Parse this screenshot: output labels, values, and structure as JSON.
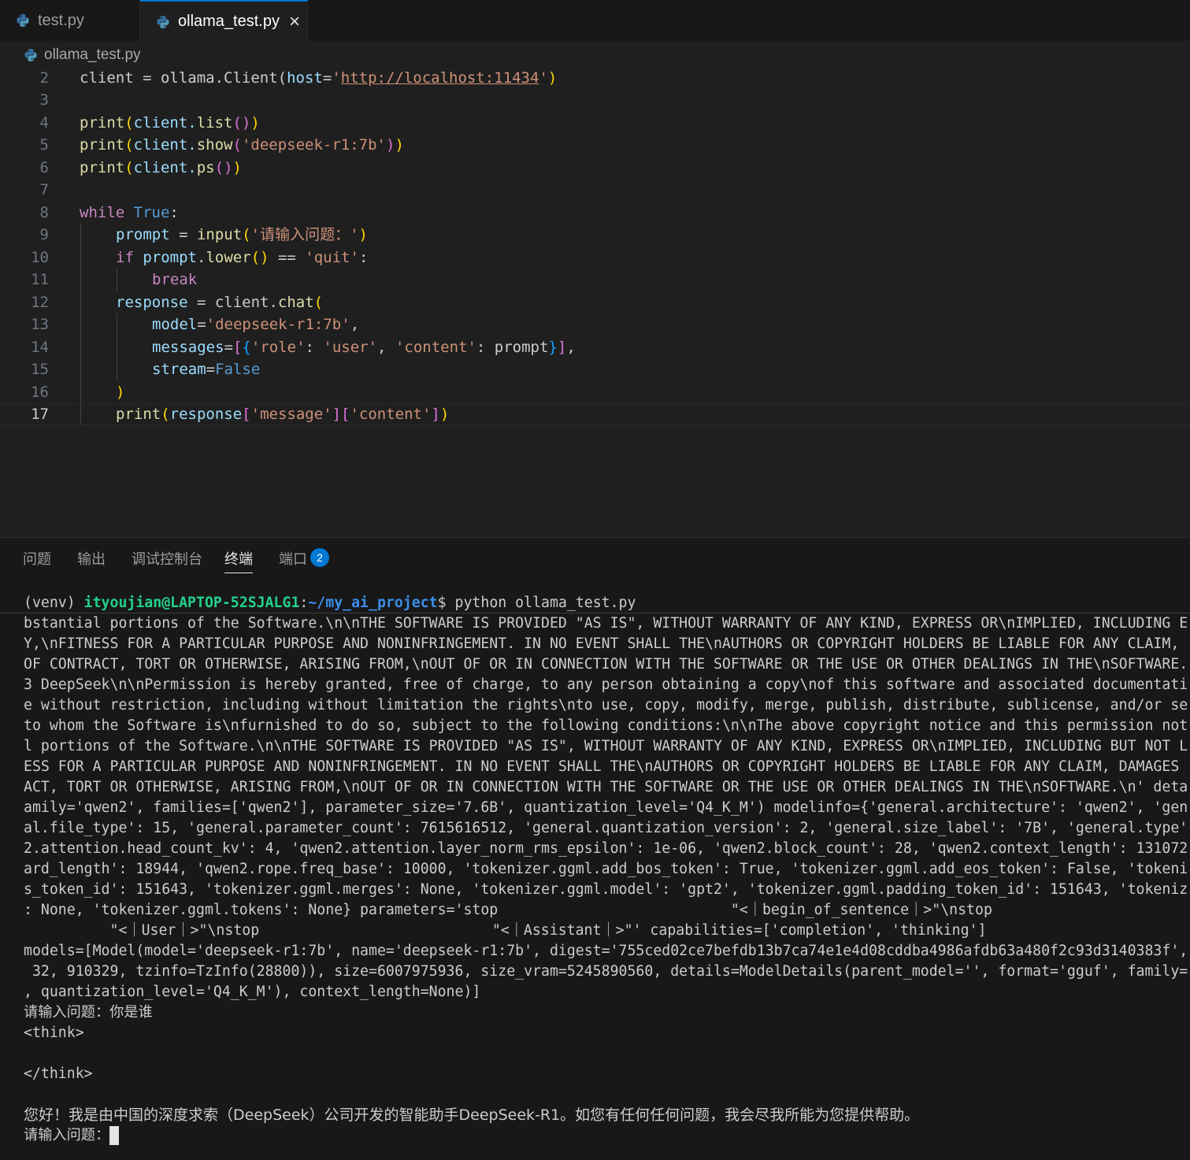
{
  "tabs": [
    {
      "label": "test.py"
    },
    {
      "label": "ollama_test.py"
    }
  ],
  "breadcrumb": {
    "file": "ollama_test.py"
  },
  "editor": {
    "line_numbers": [
      "2",
      "3",
      "4",
      "5",
      "6",
      "7",
      "8",
      "9",
      "10",
      "11",
      "12",
      "13",
      "14",
      "15",
      "16",
      "17"
    ],
    "current_line": "17",
    "code": {
      "l2": {
        "a": "client = ollama.Client(",
        "b": "host",
        "c": "=",
        "d": "'",
        "e": "http://localhost:11434",
        "f": "'",
        "g": ")"
      },
      "l4": {
        "a": "print",
        "b": "(",
        "c": "client.",
        "d": "list",
        "e": "()",
        "f": ")"
      },
      "l5": {
        "a": "print",
        "b": "(",
        "c": "client.",
        "d": "show",
        "e": "(",
        "f": "'deepseek-r1:7b'",
        "g": ")",
        "h": ")"
      },
      "l6": {
        "a": "print",
        "b": "(",
        "c": "client.",
        "d": "ps",
        "e": "()",
        "f": ")"
      },
      "l8": {
        "a": "while",
        "b": "True",
        "c": ":"
      },
      "l9": {
        "a": "prompt",
        "b": " = ",
        "c": "input",
        "d": "(",
        "e": "'请输入问题：'",
        "f": ")"
      },
      "l10": {
        "a": "if",
        "b": "prompt",
        "c": ".",
        "d": "lower",
        "e": "()",
        "f": " == ",
        "g": "'quit'",
        "h": ":"
      },
      "l11": {
        "a": "break"
      },
      "l12": {
        "a": "response",
        "b": " = client.",
        "c": "chat",
        "d": "("
      },
      "l13": {
        "a": "model",
        "b": "=",
        "c": "'deepseek-r1:7b'",
        "d": ","
      },
      "l14": {
        "a": "messages",
        "b": "=",
        "c": "[",
        "d": "{",
        "e": "'role'",
        "f": ": ",
        "g": "'user'",
        "h": ", ",
        "i": "'content'",
        "j": ": prompt",
        "k": "}",
        "l": "]",
        "m": ","
      },
      "l15": {
        "a": "stream",
        "b": "=",
        "c": "False"
      },
      "l16": {
        "a": ")"
      },
      "l17": {
        "a": "print",
        "b": "(",
        "c": "response",
        "d": "[",
        "e": "'message'",
        "f": "][",
        "g": "'content'",
        "h": "]",
        "i": ")"
      }
    }
  },
  "panel": {
    "tabs": [
      {
        "label": "问题"
      },
      {
        "label": "输出"
      },
      {
        "label": "调试控制台"
      },
      {
        "label": "终端"
      },
      {
        "label": "端口"
      }
    ],
    "active_tab": "终端",
    "ports_badge": "2"
  },
  "terminal": {
    "prompt": {
      "venv": "(venv) ",
      "user": "ityoujian@LAPTOP-52SJALG1",
      "colon": ":",
      "path": "~/my_ai_project",
      "dollar": "$ ",
      "command": "python ollama_test.py"
    },
    "lines": [
      "bstantial portions of the Software.\\n\\nTHE SOFTWARE IS PROVIDED \"AS IS\", WITHOUT WARRANTY OF ANY KIND, EXPRESS OR\\nIMPLIED, INCLUDING E",
      "Y,\\nFITNESS FOR A PARTICULAR PURPOSE AND NONINFRINGEMENT. IN NO EVENT SHALL THE\\nAUTHORS OR COPYRIGHT HOLDERS BE LIABLE FOR ANY CLAIM,",
      "OF CONTRACT, TORT OR OTHERWISE, ARISING FROM,\\nOUT OF OR IN CONNECTION WITH THE SOFTWARE OR THE USE OR OTHER DEALINGS IN THE\\nSOFTWARE.",
      "3 DeepSeek\\n\\nPermission is hereby granted, free of charge, to any person obtaining a copy\\nof this software and associated documentati",
      "e without restriction, including without limitation the rights\\nto use, copy, modify, merge, publish, distribute, sublicense, and/or se",
      "to whom the Software is\\nfurnished to do so, subject to the following conditions:\\n\\nThe above copyright notice and this permission not",
      "l portions of the Software.\\n\\nTHE SOFTWARE IS PROVIDED \"AS IS\", WITHOUT WARRANTY OF ANY KIND, EXPRESS OR\\nIMPLIED, INCLUDING BUT NOT L",
      "ESS FOR A PARTICULAR PURPOSE AND NONINFRINGEMENT. IN NO EVENT SHALL THE\\nAUTHORS OR COPYRIGHT HOLDERS BE LIABLE FOR ANY CLAIM, DAMAGES",
      "ACT, TORT OR OTHERWISE, ARISING FROM,\\nOUT OF OR IN CONNECTION WITH THE SOFTWARE OR THE USE OR OTHER DEALINGS IN THE\\nSOFTWARE.\\n' deta",
      "amily='qwen2', families=['qwen2'], parameter_size='7.6B', quantization_level='Q4_K_M') modelinfo={'general.architecture': 'qwen2', 'gen",
      "al.file_type': 15, 'general.parameter_count': 7615616512, 'general.quantization_version': 2, 'general.size_label': '7B', 'general.type'",
      "2.attention.head_count_kv': 4, 'qwen2.attention.layer_norm_rms_epsilon': 1e-06, 'qwen2.block_count': 28, 'qwen2.context_length': 131072",
      "ard_length': 18944, 'qwen2.rope.freq_base': 10000, 'tokenizer.ggml.add_bos_token': True, 'tokenizer.ggml.add_eos_token': False, 'tokeni",
      "s_token_id': 151643, 'tokenizer.ggml.merges': None, 'tokenizer.ggml.model': 'gpt2', 'tokenizer.ggml.padding_token_id': 151643, 'tokeniz",
      ": None, 'tokenizer.ggml.tokens': None} parameters='stop                           \"<｜begin_of_sentence｜>\"\\nstop",
      "          \"<｜User｜>\"\\nstop                           \"<｜Assistant｜>\"' capabilities=['completion', 'thinking']",
      "models=[Model(model='deepseek-r1:7b', name='deepseek-r1:7b', digest='755ced02ce7befdb13b7ca74e1e4d08cddba4986afdb63a480f2c93d3140383f',",
      " 32, 910329, tzinfo=TzInfo(28800)), size=6007975936, size_vram=5245890560, details=ModelDetails(parent_model='', format='gguf', family=",
      ", quantization_level='Q4_K_M'), context_length=None)]",
      "请输入问题：你是谁",
      "<think>",
      "",
      "</think>",
      "",
      "您好！我是由中国的深度求索（DeepSeek）公司开发的智能助手DeepSeek-R1。如您有任何任何问题，我会尽我所能为您提供帮助。",
      "请输入问题："
    ]
  }
}
